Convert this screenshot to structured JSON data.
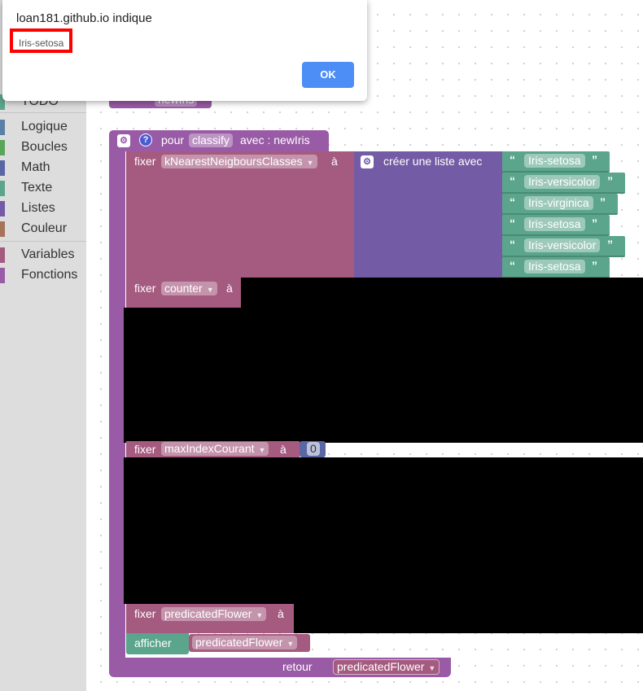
{
  "dialog": {
    "title": "loan181.github.io indique",
    "message": "Iris-setosa",
    "ok_label": "OK"
  },
  "toolbox": {
    "partial_top": "TODO",
    "categories": [
      {
        "label": "Logique",
        "color": "#5b80a5"
      },
      {
        "label": "Boucles",
        "color": "#5ba55b"
      },
      {
        "label": "Math",
        "color": "#5b67a5"
      },
      {
        "label": "Texte",
        "color": "#5ba58c"
      },
      {
        "label": "Listes",
        "color": "#745ba5"
      },
      {
        "label": "Couleur",
        "color": "#a5745b"
      },
      {
        "label": "Variables",
        "color": "#a55b80"
      },
      {
        "label": "Fonctions",
        "color": "#995ba5"
      }
    ]
  },
  "workspace": {
    "partial_block": "newIris",
    "function_block": {
      "pour": "pour",
      "name": "classify",
      "avec": "avec : newIris",
      "retour": "retour",
      "return_var": "predicatedFlower"
    },
    "set1": {
      "fixer": "fixer",
      "var": "kNearestNeigboursClasses",
      "a": "à"
    },
    "create_list": {
      "label": "créer une liste avec",
      "items": [
        "Iris-setosa",
        "Iris-versicolor",
        "Iris-virginica",
        "Iris-setosa",
        "Iris-versicolor",
        "Iris-setosa"
      ]
    },
    "set2": {
      "fixer": "fixer",
      "var": "counter",
      "a": "à"
    },
    "set3": {
      "fixer": "fixer",
      "var": "maxIndexCourant",
      "a": "à",
      "value": "0"
    },
    "set4": {
      "fixer": "fixer",
      "var": "predicatedFlower",
      "a": "à"
    },
    "print": {
      "label": "afficher",
      "var": "predicatedFlower"
    },
    "quote_open": "“",
    "quote_close": "”"
  },
  "colors": {
    "procedure": "#995ba5",
    "variable": "#a55b80",
    "list": "#745ba5",
    "text": "#5ba58c",
    "math": "#5b67a5",
    "dialog_ok": "#4d8ef6"
  }
}
